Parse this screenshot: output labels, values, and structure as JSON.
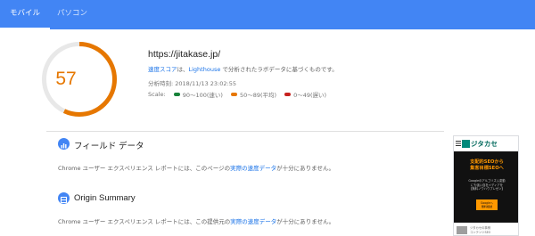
{
  "tabs": [
    {
      "label": "モバイル",
      "active": true
    },
    {
      "label": "パソコン",
      "active": false
    }
  ],
  "score": {
    "value": "57",
    "fraction": 0.57,
    "color": "#e67700",
    "track_color": "#e8e8e8"
  },
  "summary": {
    "url": "https://jitakase.jp/",
    "desc_link": "速度スコア",
    "desc_mid": "は、",
    "desc_link2": "Lighthouse",
    "desc_end": " で分析されたラボデータに基づくものです。",
    "date": "分析時刻: 2018/11/13 23:02:55",
    "scale_label": "Scale:",
    "scale_items": [
      {
        "color": "#178239",
        "label": "90～100(速い)"
      },
      {
        "color": "#e67700",
        "label": "50～89(平均)"
      },
      {
        "color": "#c7221f",
        "label": "0～49(遅い)"
      }
    ]
  },
  "sections": {
    "field": {
      "icon": "bar-chart-icon",
      "title": "フィールド データ",
      "body_pre": "Chrome ユーザー エクスペリエンス レポートには、このページの",
      "body_link": "実際の速度データ",
      "body_post": "が十分にありません。"
    },
    "origin": {
      "icon": "domain-icon",
      "title": "Origin Summary",
      "body_pre": "Chrome ユーザー エクスペリエンス レポートには、この提供元の",
      "body_link": "実際の速度データ",
      "body_post": "が十分にありません。"
    }
  },
  "preview": {
    "logo": "ジタカセ",
    "headline1": "支配的SEOから",
    "headline2": "集客目標SEOへ",
    "line1": "Googleのアルゴリズム変動",
    "line2": "にも強い自社メディアを",
    "line3": "【無料ノウハウプレゼン】",
    "btn1": "Googleへ",
    "btn2": "無料相談",
    "btn3": "ご覧ください",
    "foot1": "ジタカセの事例",
    "foot2": "コンテンツSEO"
  },
  "colors": {
    "tabbar": "#4285f4",
    "link": "#1a73e8",
    "section_icon": "#4285f4"
  }
}
